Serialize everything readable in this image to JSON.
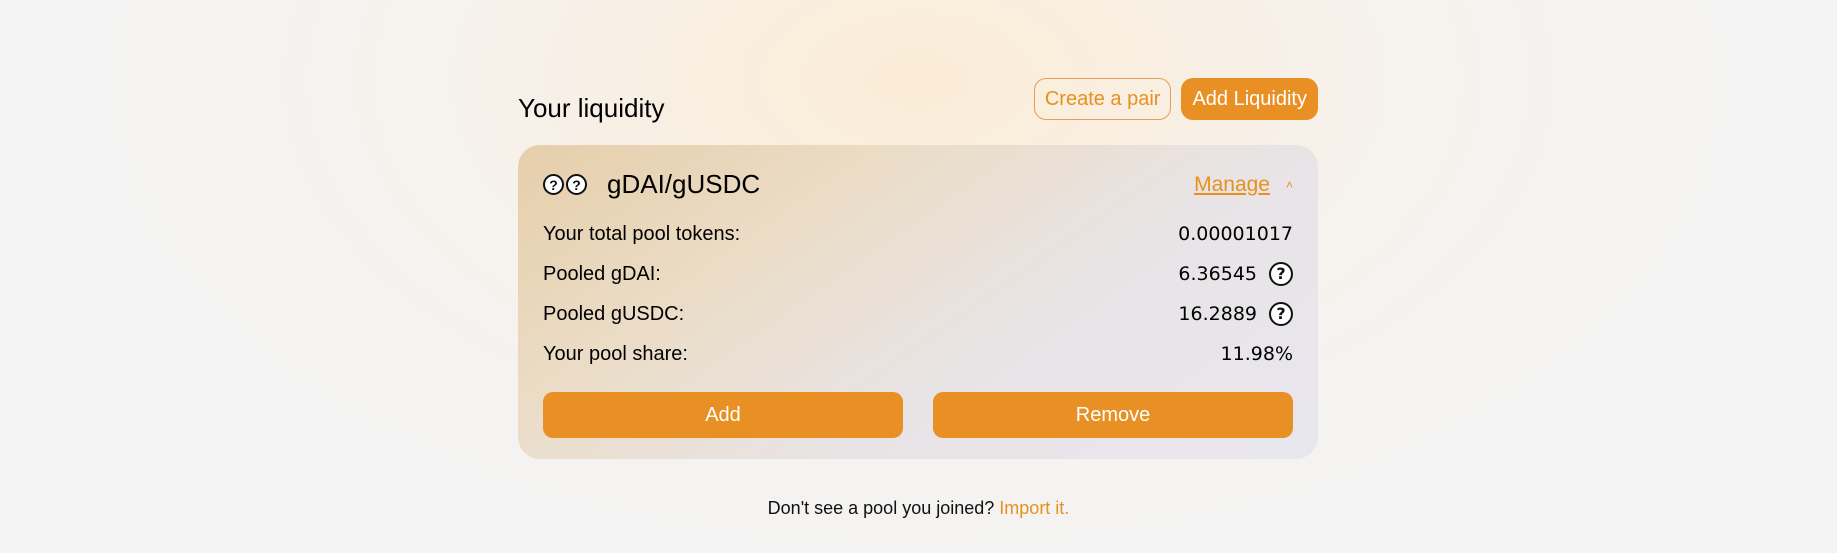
{
  "header": {
    "title": "Your liquidity",
    "create_pair_label": "Create a pair",
    "add_liquidity_label": "Add Liquidity"
  },
  "pool": {
    "pair_name": "gDAI/gUSDC",
    "token_icon": "question-circle-icon",
    "manage_label": "Manage",
    "chevron": "˄",
    "rows": [
      {
        "label": "Your total pool tokens:",
        "value": "0.00001017",
        "icon": false
      },
      {
        "label": "Pooled gDAI:",
        "value": "6.36545",
        "icon": true
      },
      {
        "label": "Pooled gUSDC:",
        "value": "16.2889",
        "icon": true
      },
      {
        "label": "Your pool share:",
        "value": "11.98%",
        "icon": false
      }
    ],
    "add_label": "Add",
    "remove_label": "Remove"
  },
  "footer": {
    "text": "Don't see a pool you joined?",
    "link_label": "Import it."
  },
  "colors": {
    "accent": "#e8901f",
    "button": "#e89023"
  }
}
